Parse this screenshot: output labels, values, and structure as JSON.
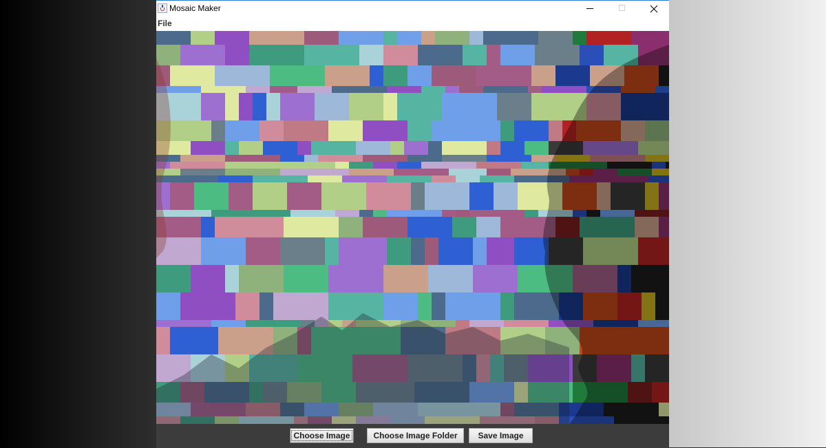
{
  "window": {
    "title": "Mosaic Maker"
  },
  "menu": {
    "items": [
      "File"
    ]
  },
  "buttons": {
    "choose_image": "Choose Image",
    "choose_folder": "Choose Image Folder",
    "save_image": "Save Image"
  },
  "icons": {
    "app": "java-cup-icon",
    "minimize": "minimize-icon",
    "maximize": "maximize-icon",
    "close": "close-icon"
  },
  "palette": [
    "#a25c86",
    "#8f4fc2",
    "#4b6a8c",
    "#8fb27d",
    "#3e9b7d",
    "#9d5a7a",
    "#2f60d3",
    "#9c6fd1",
    "#b1cf86",
    "#55b4a2",
    "#c07a86",
    "#cba08a",
    "#a9d2d9",
    "#6e9fe8",
    "#4cbc83",
    "#d08c9a",
    "#c1a8d0",
    "#dfe9a0",
    "#9db8d8",
    "#6b7f8a"
  ],
  "dark_palette": [
    "#1d1d1d",
    "#b22222",
    "#8a2e6e",
    "#c8b320",
    "#2a4fb8",
    "#1f7a3c",
    "#3a3a3a",
    "#c0471b",
    "#7b1e1e",
    "#1b3a8f"
  ]
}
